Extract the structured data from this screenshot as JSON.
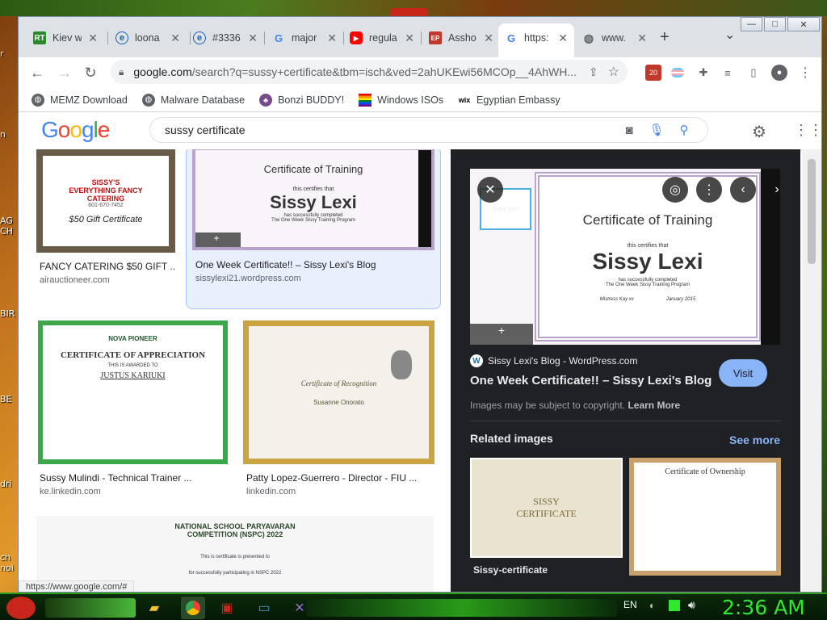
{
  "desktop": {
    "fragments": [
      "r",
      "H",
      "n",
      "AG",
      "CH",
      "BIR",
      "BE",
      "dri",
      "ch",
      "noi"
    ],
    "trash_label": ""
  },
  "window": {
    "controls": {
      "minimize": "—",
      "maximize": "□",
      "close": "✕"
    },
    "tabs": [
      {
        "title": "Kiev w",
        "icon": "RT",
        "icon_color": "#2a8a2a"
      },
      {
        "title": "loona",
        "icon": "e",
        "icon_color": "#1a5fb4"
      },
      {
        "title": "#3336",
        "icon": "e",
        "icon_color": "#1a5fb4"
      },
      {
        "title": "major",
        "icon": "G",
        "icon_color": "#ffffff"
      },
      {
        "title": "regula",
        "icon": "▶",
        "icon_color": "#ff0000"
      },
      {
        "title": "Assho",
        "icon": "EP",
        "icon_color": "#c0392b"
      },
      {
        "title": "https:",
        "icon": "G",
        "icon_color": "#ffffff",
        "active": true
      },
      {
        "title": "www.",
        "icon": "◍",
        "icon_color": "#dee1e6"
      }
    ],
    "new_tab": "+",
    "tab_menu": "⌄"
  },
  "toolbar": {
    "url_main": "google.com",
    "url_rest": "/search?q=sussy+certificate&tbm=isch&ved=2ahUKEwi56MCOp__4AhWH...",
    "ext_badge": "20"
  },
  "bookmarks": [
    {
      "label": "MEMZ Download",
      "icon": "globe-icon"
    },
    {
      "label": "Malware Database",
      "icon": "globe-icon"
    },
    {
      "label": "Bonzi BUDDY!",
      "icon": "bonzi-icon"
    },
    {
      "label": "Windows ISOs",
      "icon": "rainbow-flag-icon"
    },
    {
      "label": "Egyptian Embassy",
      "icon": "wix-icon"
    }
  ],
  "google": {
    "logo": "Google",
    "query": "sussy certificate"
  },
  "results": [
    {
      "caption": "FANCY CATERING $50 GIFT ...",
      "source": "airauctioneer.com",
      "thumb_text": [
        "SISSY'S",
        "EVERYTHING FANCY",
        "CATERING",
        "601-670-7452",
        "$50 Gift Certificate"
      ]
    },
    {
      "caption": "One Week Certificate!! – Sissy Lexi's Blog",
      "source": "sissylexi21.wordpress.com",
      "thumb_text": [
        "Certificate of Training",
        "this certifies that",
        "Sissy Lexi",
        "has successfully completed",
        "The One Week Sissy Training Program"
      ]
    },
    {
      "caption": "Sussy Mulindi - Technical Trainer ...",
      "source": "ke.linkedin.com",
      "thumb_text": [
        "NOVA PIONEER",
        "CERTIFICATE OF APPRECIATION",
        "THIS IS AWARDED TO",
        "JUSTUS KARIUKI"
      ]
    },
    {
      "caption": "Patty Lopez-Guerrero - Director - FIU ...",
      "source": "linkedin.com",
      "thumb_text": [
        "Certificate of Recognition",
        "Susanne Onorato"
      ]
    },
    {
      "caption": "",
      "source": "",
      "thumb_text": [
        "NATIONAL SCHOOL PARYAVARAN",
        "COMPETITION (NSPC) 2022",
        "This is certificate is presented to",
        "for successfully participating in NSPC 2022"
      ]
    }
  ],
  "panel": {
    "img_title": "Certificate of Training",
    "img_sub": "this certifies that",
    "img_name": "Sissy Lexi",
    "img_line1": "has successfully completed",
    "img_line2": "The One Week Sissy Training Program",
    "img_signed": "Mistress Kay xx",
    "img_date": "January 2015",
    "site": "Sissy Lexi's Blog - WordPress.com",
    "title": "One Week Certificate!! – Sissy Lexi's Blog",
    "visit": "Visit",
    "copyright": "Images may be subject to copyright.",
    "learn_more": "Learn More",
    "related": "Related images",
    "see_more": "See more",
    "related_items": [
      {
        "caption": "Sissy-certificate",
        "thumb_text": [
          "SISSY",
          "CERTIFICATE"
        ]
      },
      {
        "caption": "",
        "thumb_text": [
          "Certificate of Ownership"
        ]
      }
    ]
  },
  "status_url": "https://www.google.com/#",
  "taskbar": {
    "lang": "EN",
    "clock": "2:36 AM"
  },
  "colors": {
    "google_blue": "#1a73e8",
    "clock_green": "#2ee82e",
    "visit_btn": "#8ab4f8"
  }
}
